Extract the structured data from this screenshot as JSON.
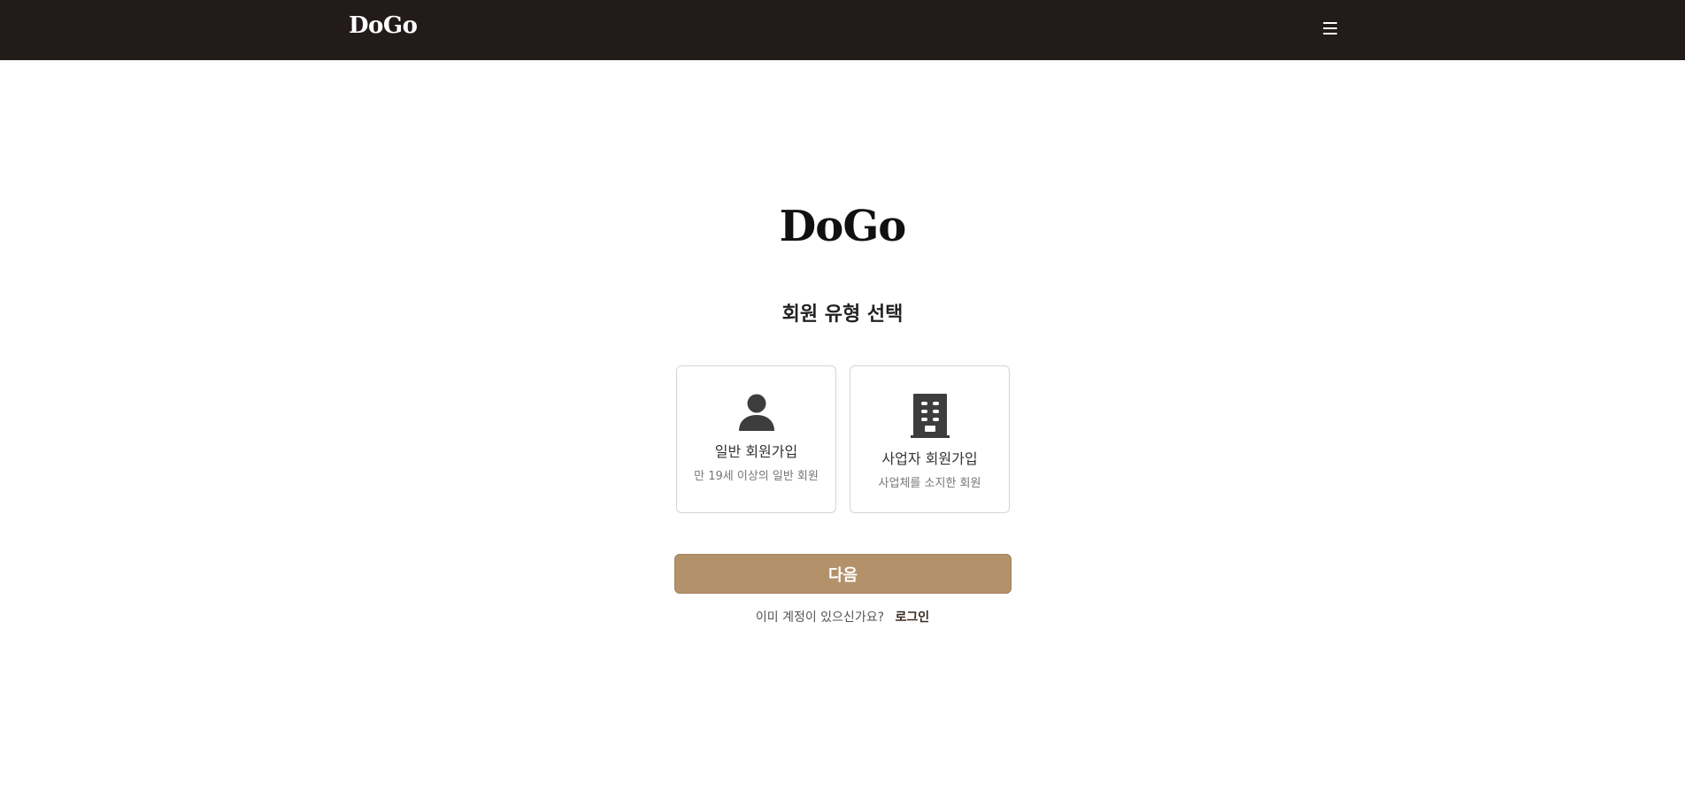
{
  "navbar": {
    "logo": "DoGo",
    "menu_icon": "hamburger-menu-icon"
  },
  "main": {
    "brand": "DoGo",
    "heading": "회원 유형 선택",
    "options": [
      {
        "icon": "person-icon",
        "title": "일반 회원가입",
        "description": "만 19세 이상의 일반 회원"
      },
      {
        "icon": "building-icon",
        "title": "사업자 회원가입",
        "description": "사업체를 소지한 회원"
      }
    ],
    "next_label": "다음",
    "login_prompt": "이미 계정이 있으신가요?",
    "login_link": "로그인"
  },
  "colors": {
    "navbar_bg": "#231a1a",
    "accent": "#b3916b",
    "icon": "#3d3d3d"
  }
}
